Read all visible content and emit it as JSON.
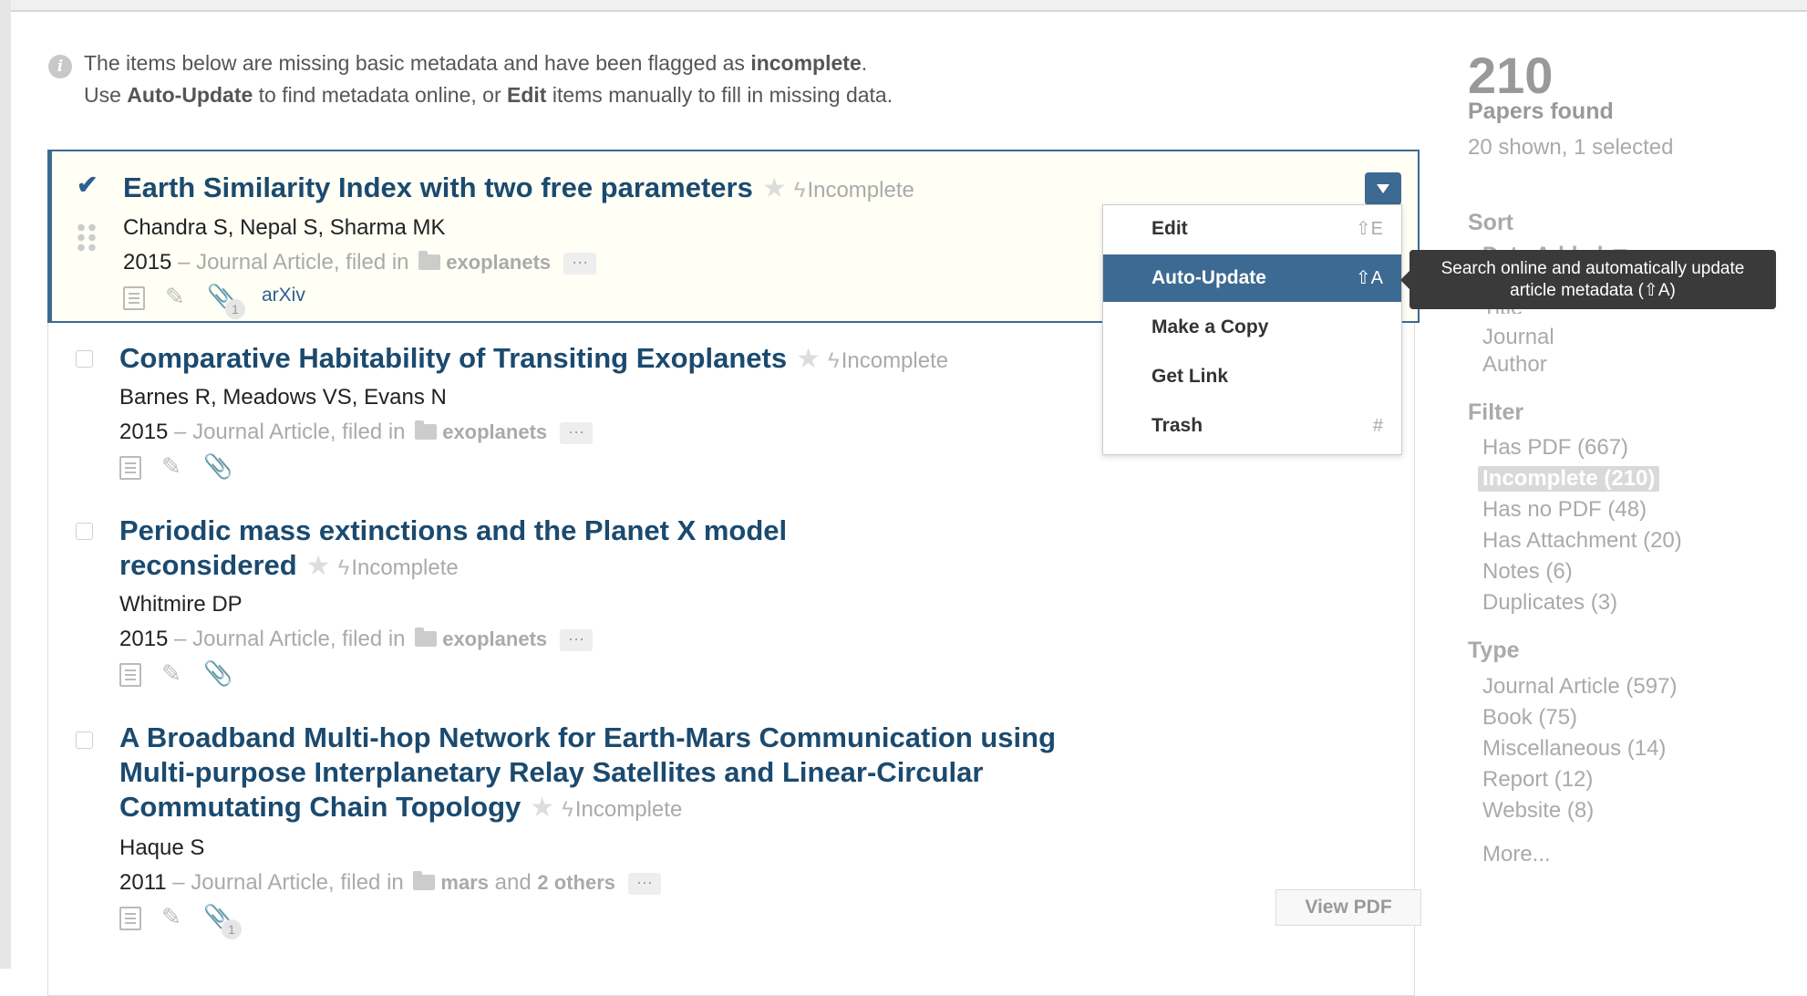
{
  "notice": {
    "part1": "The items below are missing basic metadata and have been flagged as ",
    "bold1": "incomplete",
    "part2": ".",
    "part3": "Use ",
    "bold2": "Auto-Update",
    "part4": " to find metadata online, or ",
    "bold3": "Edit",
    "part5": " items manually to fill in missing data."
  },
  "items": [
    {
      "title": "Earth Similarity Index with two free parameters",
      "status": "Incomplete",
      "authors": "Chandra S, Nepal S, Sharma MK",
      "year": "2015",
      "meta": " – Journal Article, filed in ",
      "folder": "exoplanets",
      "attachments": "1",
      "link": "arXiv",
      "selected": true
    },
    {
      "title": "Comparative Habitability of Transiting Exoplanets",
      "status": "Incomplete",
      "authors": "Barnes R, Meadows VS, Evans N",
      "year": "2015",
      "meta": " – Journal Article, filed in ",
      "folder": "exoplanets"
    },
    {
      "title_l1": "Periodic mass extinctions and the Planet X model",
      "title_l2": "reconsidered",
      "status": "Incomplete",
      "authors": "Whitmire DP",
      "year": "2015",
      "meta": " – Journal Article, filed in ",
      "folder": "exoplanets"
    },
    {
      "title_l1": "A Broadband Multi-hop Network for Earth-Mars Communication using",
      "title_l2": "Multi-purpose Interplanetary Relay Satellites and Linear-Circular",
      "title_l3": "Commutating Chain Topology",
      "status": "Incomplete",
      "authors": "Haque S",
      "year": "2011",
      "meta": " – Journal Article, filed in ",
      "folder": "mars",
      "folder_and": " and ",
      "folder_others": "2 others",
      "attachments": "1",
      "view_pdf": "View PDF"
    }
  ],
  "menu": {
    "items": [
      {
        "label": "Edit",
        "shortcut": "⇧E"
      },
      {
        "label": "Auto-Update",
        "shortcut": "⇧A"
      },
      {
        "label": "Make a Copy",
        "shortcut": ""
      },
      {
        "label": "Get Link",
        "shortcut": ""
      },
      {
        "label": "Trash",
        "shortcut": "#"
      }
    ],
    "active": "Auto-Update"
  },
  "tooltip": {
    "line1": "Search online and automatically update",
    "line2": "article metadata (⇧A)"
  },
  "sidebar": {
    "count": "210",
    "count_label": "Papers found",
    "shown": "20 shown, 1 selected",
    "sort_header": "Sort",
    "sort_options": [
      "Date Added ▼",
      "Title",
      "Journal",
      "Author"
    ],
    "filter_header": "Filter",
    "filters": [
      "Has PDF (667)",
      "Incomplete (210)",
      "Has no PDF (48)",
      "Has Attachment (20)",
      "Notes (6)",
      "Duplicates (3)"
    ],
    "active_filter": "Incomplete (210)",
    "type_header": "Type",
    "types": [
      "Journal Article (597)",
      "Book (75)",
      "Miscellaneous (14)",
      "Report (12)",
      "Website (8)"
    ],
    "more": "More..."
  },
  "colors": {
    "accent": "#3d6a92",
    "title": "#1b4a6f",
    "muted": "#aaaaaa"
  }
}
